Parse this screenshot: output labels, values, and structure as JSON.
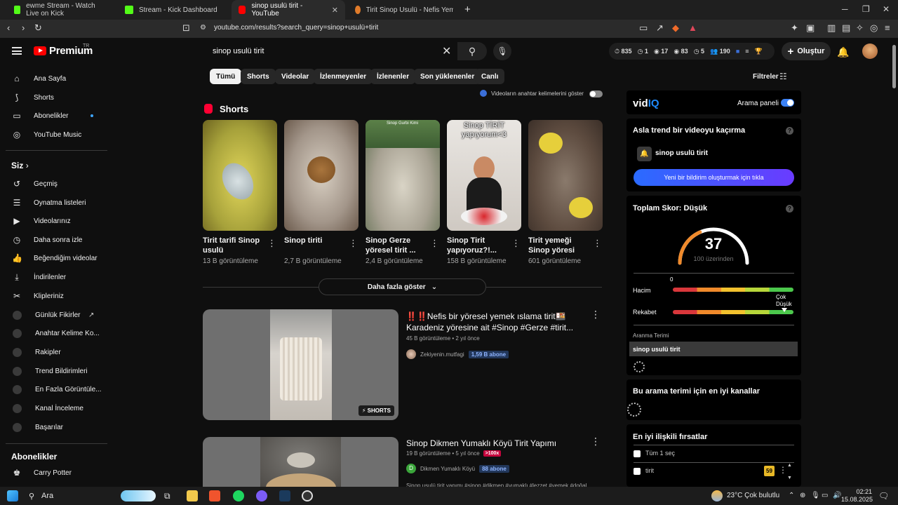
{
  "browser": {
    "tabs": [
      {
        "label": "ewme Stream - Watch Live on Kick",
        "active": false
      },
      {
        "label": "Stream - Kick Dashboard",
        "active": false
      },
      {
        "label": "sinop usulü tirit - YouTube",
        "active": true
      },
      {
        "label": "Tirit Sinop Usulü - Nefis Yemek Tarifle",
        "active": false
      }
    ],
    "url": "youtube.com/results?search_query=sinop+usulü+tirit"
  },
  "header": {
    "logo": "Premium",
    "logo_region": "TR",
    "search_value": "sinop usulü tirit",
    "stats": [
      "835",
      "1",
      "17",
      "83",
      "5",
      "190"
    ],
    "create_label": "Oluştur"
  },
  "sidebar": {
    "main": [
      "Ana Sayfa",
      "Shorts",
      "Abonelikler",
      "YouTube Music"
    ],
    "you_heading": "Siz",
    "you_items": [
      "Geçmiş",
      "Oynatma listeleri",
      "Videolarınız",
      "Daha sonra izle",
      "Beğendiğim videolar",
      "İndirilenler",
      "Klipleriniz"
    ],
    "ext_items": [
      "Günlük Fikirler",
      "Anahtar Kelime Ko...",
      "Rakipler",
      "Trend Bildirimleri",
      "En Fazla Görüntüle...",
      "Kanal İnceleme",
      "Başarılar"
    ],
    "subs_heading": "Abonelikler",
    "subs_items": [
      "Carry Potter"
    ]
  },
  "chips": [
    "Tümü",
    "Shorts",
    "Videolar",
    "İzlenmeyenler",
    "İzlenenler",
    "Son yüklenenler",
    "Canlı"
  ],
  "filters_label": "Filtreler",
  "keyword_toggle_label": "Videoların anahtar kelimelerini göster",
  "shorts": {
    "heading": "Shorts",
    "items": [
      {
        "title": "Tirit tarifi Sinop usulü",
        "views": "13 B görüntüleme"
      },
      {
        "title": "Sinop tiriti",
        "views": "2,7 B görüntüleme"
      },
      {
        "title": "Sinop Gerze yöresel tirit ...",
        "views": "2,4 B görüntüleme"
      },
      {
        "title": "Sinop Tirit yapıyoruz?!...",
        "views": "158 B görüntüleme",
        "overlay": "Sinop TİRİT yapıyorum<3"
      },
      {
        "title": "Tirit yemeği Sinop yöresi",
        "views": "601 görüntüleme"
      }
    ],
    "more_label": "Daha fazla göster",
    "second_thumb_caption": "Sinop Gurbi Kimi"
  },
  "videos": [
    {
      "title": "‼️‼️Nefis bir yöresel yemek ıslama tirit🍱 Karadeniz yöresine ait #Sinop #Gerze #tirit...",
      "meta": "45 B görüntüleme • 2 yıl önce",
      "channel": "Zekiyenin.mutfagi",
      "subs": "1,59 B abone",
      "badge": "SHORTS"
    },
    {
      "title": "Sinop Dikmen Yumaklı Köyü Tirit Yapımı",
      "meta": "19 B görüntüleme • 5 yıl önce",
      "x100": ">100x",
      "channel": "Dikmen Yumaklı Köyü",
      "channel_initial": "D",
      "subs": "88 abone",
      "tags": "Sinop usulü tirit yapımı #sinop #dikmen #yumaklı #lezzet #yemek #doğal"
    }
  ],
  "vidiq": {
    "logo_main": "vid",
    "logo_accent": "IQ",
    "panel_label": "Arama paneli",
    "trend_heading": "Asla trend bir videoyu kaçırma",
    "trend_term": "sinop usulü tirit",
    "notify_button": "Yeni bir bildirim oluşturmak için tıkla",
    "score_heading": "Toplam Skor: Düşük",
    "score": "37",
    "score_sub": "100 üzerinden",
    "score_value": 0.37,
    "volume_label": "Hacim",
    "volume_value": "0",
    "competition_label": "Rekabet",
    "competition_note": "Çok Düşük",
    "term_label": "Aranma Terimi",
    "term_value": "sinop usulü tirit",
    "channels_heading": "Bu arama terimi için en iyi kanallar",
    "opps_heading": "En iyi ilişkili fırsatlar",
    "select_all": "Tüm 1 seç",
    "opp_item": "tirit",
    "opp_score": "59"
  },
  "taskbar": {
    "search_label": "Ara",
    "weather": "23°C  Çok bulutlu",
    "time": "02:21",
    "date": "15.08.2025"
  },
  "colors": {
    "yt_red": "#ff0000",
    "vidiq_blue": "#3b82f6",
    "x100_red": "#c6053d"
  }
}
